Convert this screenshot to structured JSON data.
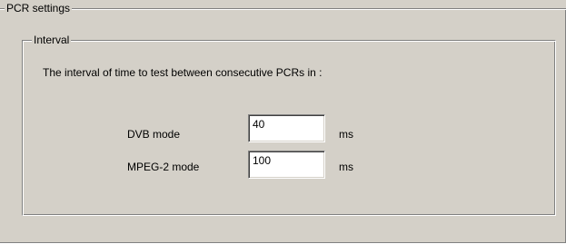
{
  "pcr_settings": {
    "title": "PCR settings",
    "interval": {
      "title": "Interval",
      "description": "The interval of time to test between  consecutive PCRs in :",
      "dvb": {
        "label": "DVB mode",
        "value": "40",
        "unit": "ms"
      },
      "mpeg2": {
        "label": "MPEG-2 mode",
        "value": "100",
        "unit": "ms"
      }
    }
  }
}
